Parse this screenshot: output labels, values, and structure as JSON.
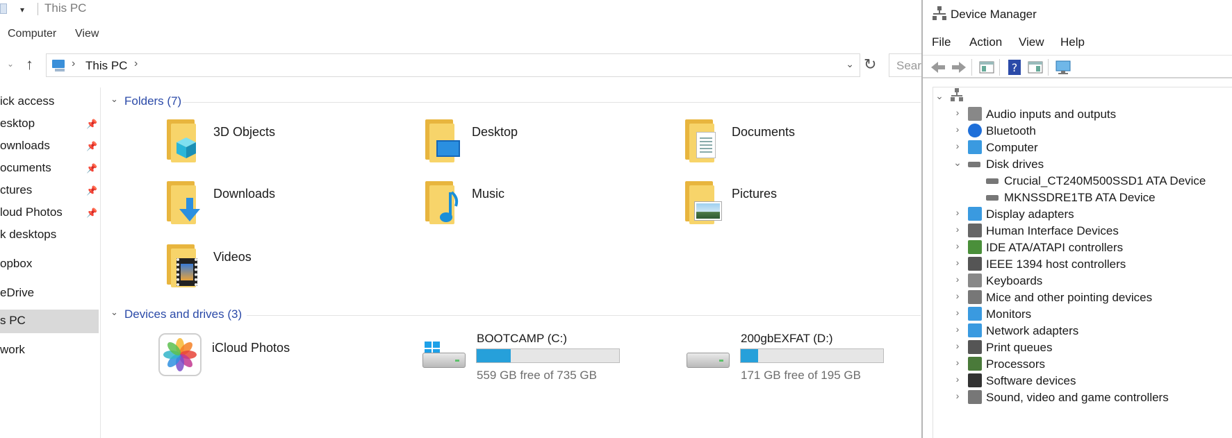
{
  "explorer": {
    "window_title": "This PC",
    "quick_access_caret": "▾",
    "ribbon_tabs": [
      "Computer",
      "View"
    ],
    "address": {
      "path": "This PC",
      "search_placeholder": "Search This PC"
    },
    "nav_items": [
      {
        "label": "Quick access",
        "shown": "ick access",
        "pinned": false
      },
      {
        "label": "Desktop",
        "shown": "esktop",
        "pinned": true
      },
      {
        "label": "Downloads",
        "shown": "ownloads",
        "pinned": true
      },
      {
        "label": "Documents",
        "shown": "ocuments",
        "pinned": true
      },
      {
        "label": "Pictures",
        "shown": "ctures",
        "pinned": true
      },
      {
        "label": "iCloud Photos",
        "shown": "loud Photos",
        "pinned": true
      },
      {
        "label": "Desk desktops",
        "shown": "k desktops",
        "pinned": false
      },
      {
        "label": "Dropbox",
        "shown": "opbox",
        "pinned": false
      },
      {
        "label": "OneDrive",
        "shown": "eDrive",
        "pinned": false
      },
      {
        "label": "This PC",
        "shown": "s PC",
        "pinned": false,
        "selected": true
      },
      {
        "label": "Network",
        "shown": "work",
        "pinned": false
      }
    ],
    "folders_group": "Folders (7)",
    "folders": [
      {
        "name": "3D Objects",
        "icon": "3d-objects-icon"
      },
      {
        "name": "Desktop",
        "icon": "desktop-folder-icon"
      },
      {
        "name": "Documents",
        "icon": "documents-folder-icon"
      },
      {
        "name": "Downloads",
        "icon": "downloads-folder-icon"
      },
      {
        "name": "Music",
        "icon": "music-folder-icon"
      },
      {
        "name": "Pictures",
        "icon": "pictures-folder-icon"
      },
      {
        "name": "Videos",
        "icon": "videos-folder-icon"
      }
    ],
    "devices_group": "Devices and drives (3)",
    "devices": [
      {
        "name": "iCloud Photos",
        "icon": "icloud-photos-icon"
      },
      {
        "name": "BOOTCAMP (C:)",
        "free_text": "559 GB free of 735 GB",
        "used_fraction": 0.24,
        "icon": "windows-drive-icon"
      },
      {
        "name": "200gbEXFAT (D:)",
        "free_text": "171 GB free of 195 GB",
        "used_fraction": 0.12,
        "icon": "drive-icon"
      }
    ]
  },
  "device_manager": {
    "title": "Device Manager",
    "menu": [
      "File",
      "Action",
      "View",
      "Help"
    ],
    "tree": [
      {
        "label": "Audio inputs and outputs",
        "expanded": false,
        "level": 1
      },
      {
        "label": "Bluetooth",
        "expanded": false,
        "level": 1
      },
      {
        "label": "Computer",
        "expanded": false,
        "level": 1
      },
      {
        "label": "Disk drives",
        "expanded": true,
        "level": 1
      },
      {
        "label": "Crucial_CT240M500SSD1 ATA Device",
        "level": 2
      },
      {
        "label": "MKNSSDRE1TB ATA Device",
        "level": 2
      },
      {
        "label": "Display adapters",
        "expanded": false,
        "level": 1
      },
      {
        "label": "Human Interface Devices",
        "expanded": false,
        "level": 1
      },
      {
        "label": "IDE ATA/ATAPI controllers",
        "expanded": false,
        "level": 1
      },
      {
        "label": "IEEE 1394 host controllers",
        "expanded": false,
        "level": 1
      },
      {
        "label": "Keyboards",
        "expanded": false,
        "level": 1
      },
      {
        "label": "Mice and other pointing devices",
        "expanded": false,
        "level": 1
      },
      {
        "label": "Monitors",
        "expanded": false,
        "level": 1
      },
      {
        "label": "Network adapters",
        "expanded": false,
        "level": 1
      },
      {
        "label": "Print queues",
        "expanded": false,
        "level": 1
      },
      {
        "label": "Processors",
        "expanded": false,
        "level": 1
      },
      {
        "label": "Software devices",
        "expanded": false,
        "level": 1
      },
      {
        "label": "Sound, video and game controllers",
        "expanded": false,
        "level": 1
      }
    ]
  },
  "colors": {
    "accent": "#26a0da",
    "group_header": "#2b4aa8",
    "folder_yellow": "#f7d46a"
  }
}
